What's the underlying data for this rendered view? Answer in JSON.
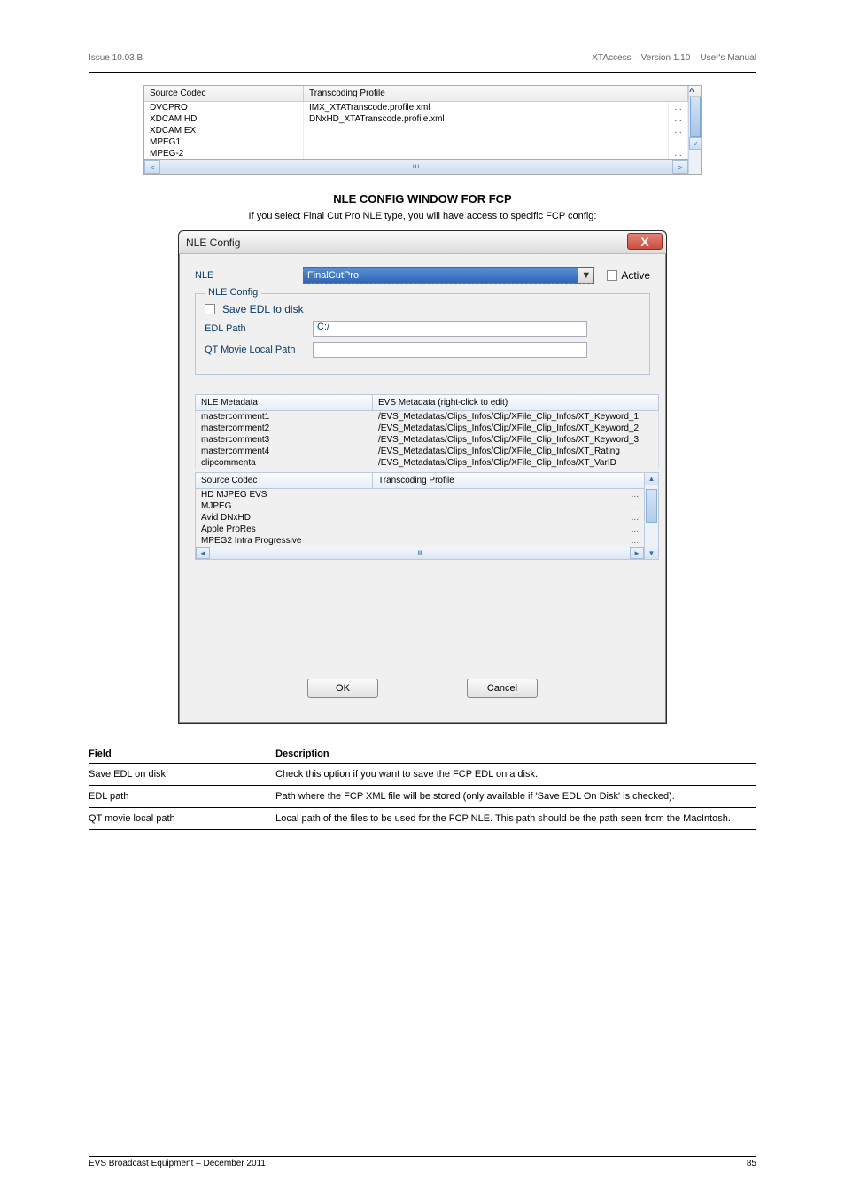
{
  "doc": {
    "header_left": "Issue 10.03.B",
    "header_right": "XTAccess – Version 1.10 – User's Manual",
    "footer_left": "EVS Broadcast Equipment – December 2011",
    "footer_right": "85"
  },
  "table1": {
    "headers": [
      "Source Codec",
      "Transcoding Profile"
    ],
    "rows": [
      {
        "codec": "DVCPRO",
        "profile": "IMX_XTATranscode.profile.xml",
        "btn": "..."
      },
      {
        "codec": "XDCAM HD",
        "profile": "DNxHD_XTATranscode.profile.xml",
        "btn": "..."
      },
      {
        "codec": "XDCAM EX",
        "profile": "",
        "btn": "..."
      },
      {
        "codec": "MPEG1",
        "profile": "",
        "btn": "..."
      },
      {
        "codec": "MPEG-2",
        "profile": "",
        "btn": "..."
      }
    ],
    "scroll_left": "<",
    "scroll_right": ">",
    "scroll_up": "˄",
    "scroll_down": "˅",
    "track": "III"
  },
  "section": {
    "title": "NLE CONFIG WINDOW FOR FCP",
    "para": "If you select Final Cut Pro NLE type, you will have access to specific FCP config:"
  },
  "dialog": {
    "title": "NLE Config",
    "close": "X",
    "nle_label": "NLE",
    "nle_value": "FinalCutPro",
    "dd_icon": "▼",
    "active_label": "Active",
    "fieldset_legend": "NLE Config",
    "save_edl_label": "Save EDL to disk",
    "edl_path_label": "EDL Path",
    "edl_path_value": "C:/",
    "qt_path_label": "QT Movie Local Path",
    "qt_path_value": "",
    "meta_headers": [
      "NLE Metadata",
      "EVS Metadata   (right-click to edit)"
    ],
    "meta_rows": [
      {
        "nle": "mastercomment1",
        "evs": "/EVS_Metadatas/Clips_Infos/Clip/XFile_Clip_Infos/XT_Keyword_1"
      },
      {
        "nle": "mastercomment2",
        "evs": "/EVS_Metadatas/Clips_Infos/Clip/XFile_Clip_Infos/XT_Keyword_2"
      },
      {
        "nle": "mastercomment3",
        "evs": "/EVS_Metadatas/Clips_Infos/Clip/XFile_Clip_Infos/XT_Keyword_3"
      },
      {
        "nle": "mastercomment4",
        "evs": "/EVS_Metadatas/Clips_Infos/Clip/XFile_Clip_Infos/XT_Rating"
      },
      {
        "nle": "clipcommenta",
        "evs": "/EVS_Metadatas/Clips_Infos/Clip/XFile_Clip_Infos/XT_VarID"
      }
    ],
    "codec_headers": [
      "Source Codec",
      "Transcoding Profile"
    ],
    "codec_rows": [
      {
        "codec": "HD MJPEG EVS",
        "btn": "..."
      },
      {
        "codec": "MJPEG",
        "btn": "..."
      },
      {
        "codec": "Avid DNxHD",
        "btn": "..."
      },
      {
        "codec": "Apple ProRes",
        "btn": "..."
      },
      {
        "codec": "MPEG2 Intra Progressive",
        "btn": "..."
      }
    ],
    "scroll_left": "◄",
    "scroll_right": "►",
    "scroll_up": "▲",
    "scroll_down": "▼",
    "track": "III",
    "ok_label": "OK",
    "cancel_label": "Cancel"
  },
  "field_desc": {
    "headers": [
      "Field",
      "Description"
    ],
    "rows": [
      {
        "f": "Save EDL on disk",
        "d": "Check this option if you want to save the FCP EDL on a disk."
      },
      {
        "f": "EDL path",
        "d": "Path where the FCP XML file will be stored (only available if 'Save EDL On Disk' is checked)."
      },
      {
        "f": "QT movie local path",
        "d": "Local path of the files to be used for the FCP NLE. This path should be the path seen from the MacIntosh."
      }
    ]
  }
}
